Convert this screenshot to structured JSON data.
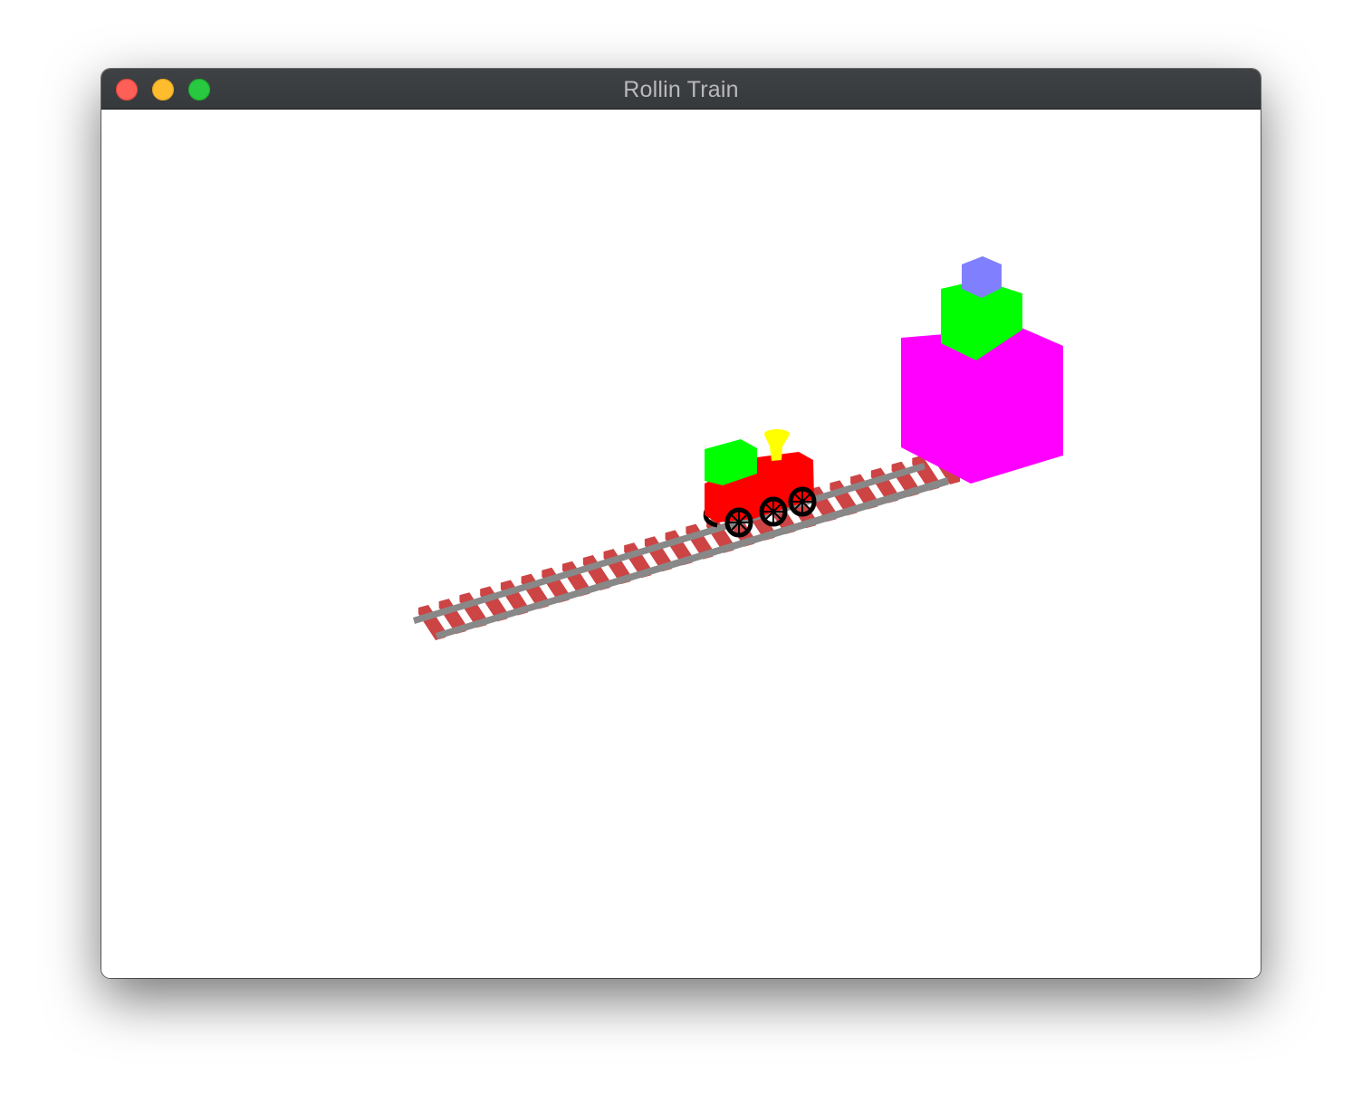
{
  "window": {
    "title": "Rollin Train"
  },
  "controls": {
    "close": "close-button",
    "minimize": "minimize-button",
    "zoom": "zoom-button"
  },
  "colors": {
    "titlebar": "#3a3d40",
    "close": "#fe5f57",
    "minimize": "#febc2e",
    "zoom": "#28c840",
    "rail": "#888888",
    "tie": "#cc4444",
    "boiler": "#ff0000",
    "cab": "#00ff00",
    "smokestack": "#ffff00",
    "wheel": "#000000",
    "block_large": "#ff00ff",
    "block_medium": "#00ff00",
    "block_small": "#8080ff"
  }
}
